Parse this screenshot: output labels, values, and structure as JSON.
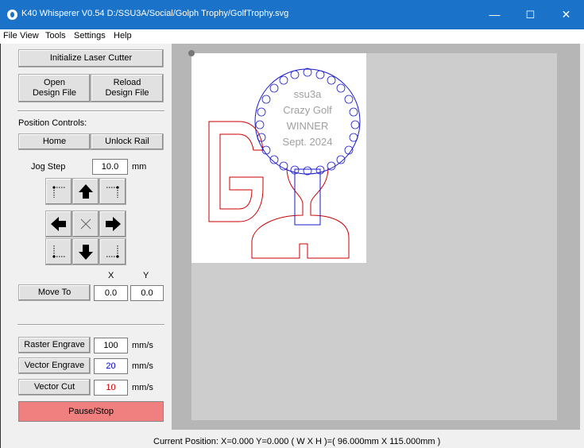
{
  "window": {
    "title": "K40 Whisperer V0.54  D:/SSU3A/Social/Golph Trophy/GolfTrophy.svg",
    "minimize": "—",
    "maximize": "☐",
    "close": "✕"
  },
  "menu": [
    "File",
    "View",
    "Tools",
    "Settings",
    "Help"
  ],
  "buttons": {
    "initialize": "Initialize Laser Cutter",
    "open_line1": "Open",
    "open_line2": "Design File",
    "reload_line1": "Reload",
    "reload_line2": "Design File",
    "home": "Home",
    "unlock_rail": "Unlock Rail",
    "move_to": "Move To",
    "raster_engrave": "Raster Engrave",
    "vector_engrave": "Vector Engrave",
    "vector_cut": "Vector Cut",
    "pause_stop": "Pause/Stop"
  },
  "labels": {
    "position_controls": "Position Controls:",
    "jog_step": "Jog Step",
    "jog_unit": "mm",
    "x": "X",
    "y": "Y",
    "speed_unit": "mm/s"
  },
  "fields": {
    "jog_step": "10.0",
    "move_x": "0.0",
    "move_y": "0.0",
    "raster_speed": "100",
    "vector_engrave_speed": "20",
    "vector_cut_speed": "10"
  },
  "colors": {
    "titlebar": "#1a73c8",
    "pause_button": "#f08080",
    "cut_path": "#cc0000",
    "engrave_path": "#1a1acc",
    "raster_text": "#a0a0a0",
    "vector_engrave_value": "#0000cc",
    "vector_cut_value": "#cc0000"
  },
  "design_text": [
    "ssu3a",
    "Crazy Golf",
    "WINNER",
    "Sept. 2024"
  ],
  "status": "Current Position: X=0.000 Y=0.000    ( W X H )=( 96.000mm X 115.000mm )"
}
